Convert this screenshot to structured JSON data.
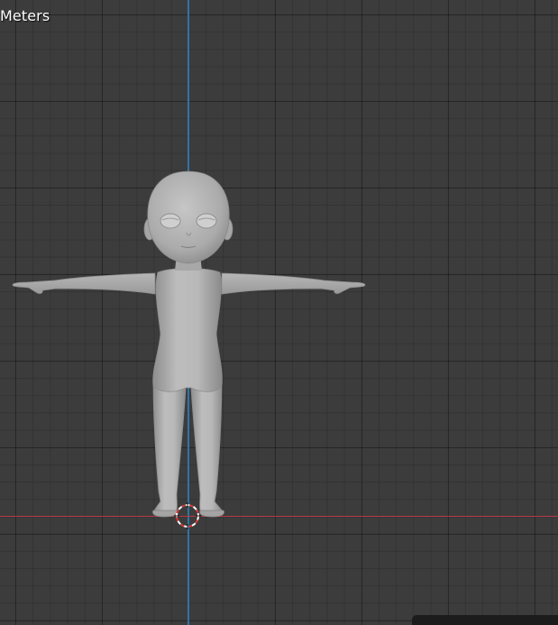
{
  "viewport": {
    "units_label": "Meters",
    "view": "front-orthographic",
    "colors": {
      "background": "#3c3c3c",
      "z_axis": "#2f74a6",
      "x_axis": "#b73a44",
      "mesh": "#b4b4b4"
    }
  },
  "scene": {
    "object": "character-base-mesh",
    "pose": "T-pose",
    "cursor_icon": "3d-cursor-icon"
  }
}
